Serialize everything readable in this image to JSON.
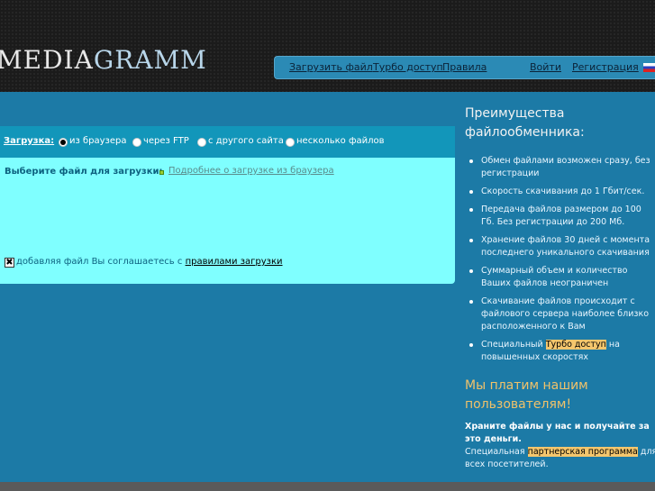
{
  "logo": {
    "part1": "MEDIA",
    "part2": "GRAMM"
  },
  "nav": {
    "upload": "Загрузить файл",
    "turbo": "Турбо доступ",
    "rules": "Правила",
    "login": "Войти",
    "register": "Регистрация",
    "flag_icon": "russian-flag-icon"
  },
  "upload": {
    "label": "Загрузка:",
    "options": [
      "из браузера",
      "через FTP",
      "с другого сайта",
      "несколько файлов"
    ],
    "selected": "из браузера",
    "choose_file": "Выберите файл для загрузки:",
    "more_link": "Подробнее о загрузке из браузера",
    "agree_text": "добавляя файл Вы соглашаетесь с",
    "agree_link": "правилами загрузки"
  },
  "sidebar": {
    "title": "Преимущества файлообменника:",
    "items": [
      "Обмен файлами возможен сразу, без регистрации",
      "Скорость скачивания до 1 Гбит/сек.",
      "Передача файлов размером до 100 Гб. Без регистрации до 200 Мб.",
      "Хранение файлов 30 дней с момента последнего уникального скачивания",
      "Суммарный объем и количество Ваших файлов неограничен",
      "Скачивание файлов происходит с файлового сервера наиболее близко расположенного к Вам"
    ],
    "special_prefix": "Специальный",
    "special_link": "Турбо доступ",
    "special_suffix": "на повышенных скоростях",
    "pay_title": "Мы платим нашим пользователям!",
    "pay_bold": "Храните файлы у нас и получайте за это деньги.",
    "pay_prefix": "Специальная",
    "pay_link": "партнерская программа",
    "pay_suffix": "для всех посетителей."
  }
}
